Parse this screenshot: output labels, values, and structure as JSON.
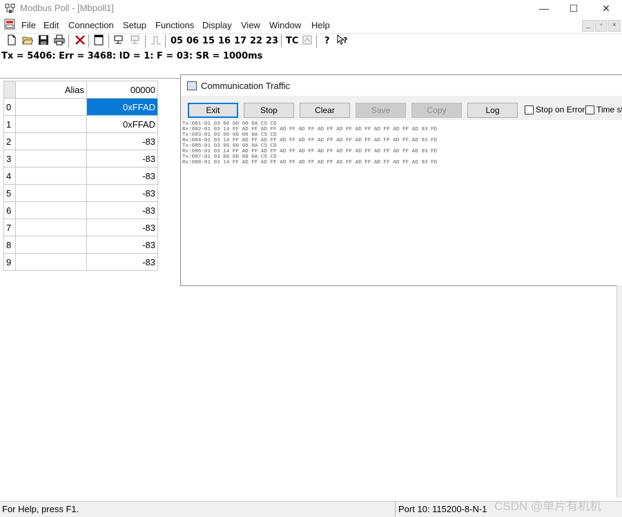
{
  "window": {
    "title": "Modbus Poll - [Mbpoll1]",
    "controls": {
      "minimize": "—",
      "maximize": "☐",
      "close": "✕"
    }
  },
  "menu": [
    "File",
    "Edit",
    "Connection",
    "Setup",
    "Functions",
    "Display",
    "View",
    "Window",
    "Help"
  ],
  "toolbar": {
    "icons": [
      "new-file-icon",
      "open-folder-icon",
      "save-icon",
      "print-icon",
      "delete-icon",
      "window-icon",
      "connect-icon",
      "disconnect-icon",
      "pulse-icon"
    ],
    "function_codes": [
      "05",
      "06",
      "15",
      "16",
      "17",
      "22",
      "23"
    ],
    "tc_label": "TC"
  },
  "status_line": "Tx = 5406: Err = 3468: ID = 1: F = 03: SR = 1000ms",
  "grid": {
    "headers": {
      "alias": "Alias",
      "value": "00000"
    },
    "rows": [
      {
        "index": "0",
        "alias": "",
        "value": "0xFFAD"
      },
      {
        "index": "1",
        "alias": "",
        "value": "0xFFAD"
      },
      {
        "index": "2",
        "alias": "",
        "value": "-83"
      },
      {
        "index": "3",
        "alias": "",
        "value": "-83"
      },
      {
        "index": "4",
        "alias": "",
        "value": "-83"
      },
      {
        "index": "5",
        "alias": "",
        "value": "-83"
      },
      {
        "index": "6",
        "alias": "",
        "value": "-83"
      },
      {
        "index": "7",
        "alias": "",
        "value": "-83"
      },
      {
        "index": "8",
        "alias": "",
        "value": "-83"
      },
      {
        "index": "9",
        "alias": "",
        "value": "-83"
      }
    ]
  },
  "comm_dialog": {
    "title": "Communication Traffic",
    "buttons": {
      "exit": "Exit",
      "stop": "Stop",
      "clear": "Clear",
      "save": "Save",
      "copy": "Copy",
      "log": "Log"
    },
    "checkboxes": {
      "stop_on_error": "Stop on Error",
      "time_stamp": "Time sta"
    },
    "log_lines": [
      "Tx:081-01 03 00 00 00 0A C5 CD",
      "Rx:082-01 03 14 FF AD FF AD FF AD FF AD FF AD FF AD FF AD FF AD FF AD FF AD 93 FD",
      "Tx:083-01 03 00 00 00 0A C5 CD",
      "Rx:084-01 03 14 FF AD FF AD FF AD FF AD FF AD FF AD FF AD FF AD FF AD FF AD 93 FD",
      "Tx:085-01 03 00 00 00 0A C5 CD",
      "Rx:086-01 03 14 FF AD FF AD FF AD FF AD FF AD FF AD FF AD FF AD FF AD FF AD 93 FD",
      "Tx:087-01 03 00 00 00 0A C5 CD",
      "Rx:088-01 03 14 FF AD FF AD FF AD FF AD FF AD FF AD FF AD FF AD FF AD FF AD 93 FD"
    ]
  },
  "statusbar": {
    "help": "For Help, press F1.",
    "port": "Port 10: 115200-8-N-1"
  },
  "watermark": "CSDN @单片有机机",
  "colors": {
    "selection": "#0a78d7",
    "focus_border": "#0078d7"
  }
}
